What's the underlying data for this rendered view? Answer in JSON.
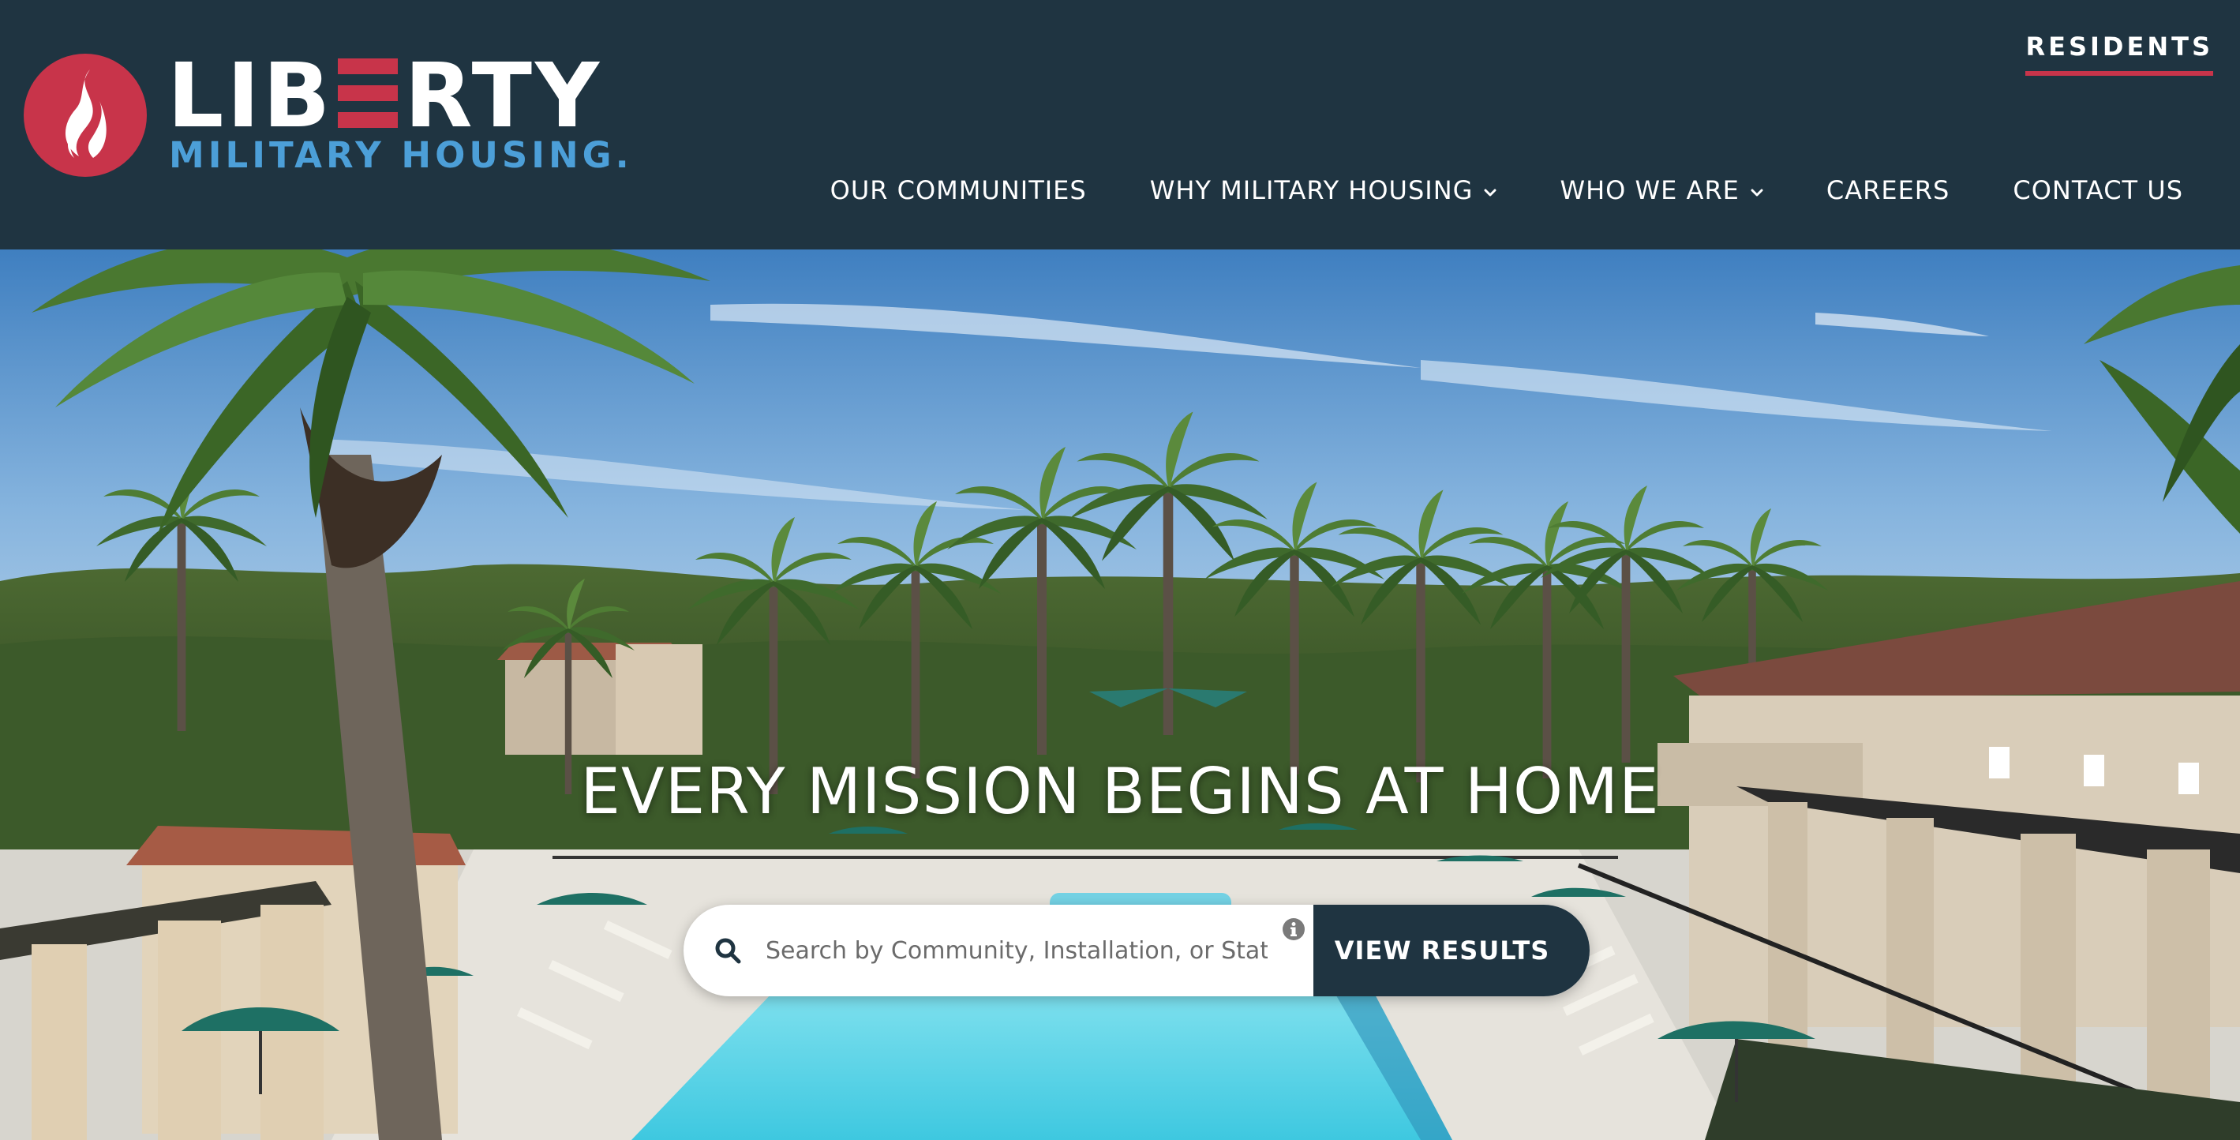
{
  "brand": {
    "word_prefix": "LIB",
    "word_suffix": "RTY",
    "subtitle": "MILITARY HOUSING",
    "trademark": ".",
    "colors": {
      "navy": "#1f3441",
      "red": "#c8344a",
      "blue": "#4c9fd8"
    }
  },
  "header": {
    "residents_label": "RESIDENTS",
    "nav": [
      {
        "label": "OUR COMMUNITIES",
        "has_dropdown": false
      },
      {
        "label": "WHY MILITARY HOUSING",
        "has_dropdown": true
      },
      {
        "label": "WHO WE ARE",
        "has_dropdown": true
      },
      {
        "label": "CAREERS",
        "has_dropdown": false
      },
      {
        "label": "CONTACT US",
        "has_dropdown": false
      }
    ]
  },
  "hero": {
    "headline": "EVERY MISSION BEGINS AT HOME",
    "background": "resort-pool-with-palm-trees",
    "search": {
      "placeholder": "Search by Community, Installation, or State",
      "value": "",
      "icon": "search-icon",
      "info_icon": "info-icon",
      "button_label": "VIEW RESULTS"
    }
  }
}
